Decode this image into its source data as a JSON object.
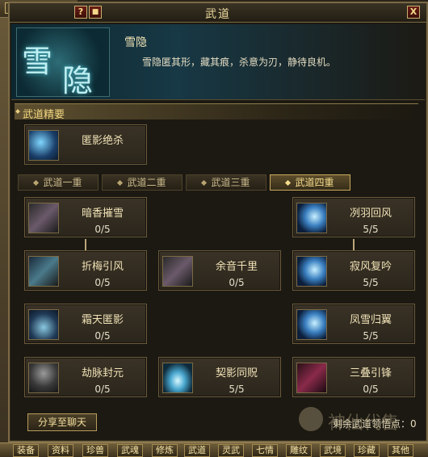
{
  "window": {
    "title": "武道",
    "help_label": "?",
    "close_label": "X"
  },
  "header": {
    "emblem_char1": "雪",
    "emblem_char2": "隐",
    "skill_name": "雪隐",
    "description": "雪隐匿其形，藏其痕，杀意为刃，静待良机。"
  },
  "essence": {
    "section_title": "武道精要",
    "card": {
      "name": "匿影绝杀",
      "icon": "ice-blade-icon"
    }
  },
  "tabs": [
    {
      "label": "武道一重",
      "active": false
    },
    {
      "label": "武道二重",
      "active": false
    },
    {
      "label": "武道三重",
      "active": false
    },
    {
      "label": "武道四重",
      "active": true
    }
  ],
  "skills": [
    {
      "name": "暗香摧雪",
      "level": "0/5",
      "icon": "blade-icon"
    },
    {
      "name": "冽羽回风",
      "level": "5/5",
      "icon": "moon-wind-icon"
    },
    {
      "name": "折梅引风",
      "level": "0/5",
      "icon": "blade-icon"
    },
    {
      "name": "余音千里",
      "level": "0/5",
      "icon": "blade-icon"
    },
    {
      "name": "寂风复吟",
      "level": "5/5",
      "icon": "moon-wind-icon"
    },
    {
      "name": "霜天匿影",
      "level": "0/5",
      "icon": "frost-icon"
    },
    {
      "name": "凤雪归翼",
      "level": "5/5",
      "icon": "moon-wind-icon"
    },
    {
      "name": "劫脉封元",
      "level": "0/5",
      "icon": "hooded-figure-icon"
    },
    {
      "name": "契影同贶",
      "level": "5/5",
      "icon": "whirlwind-icon"
    },
    {
      "name": "三叠引锋",
      "level": "0/5",
      "icon": "red-blade-icon"
    }
  ],
  "footer": {
    "share_label": "分享至聊天",
    "points_label": "剩余武道领悟点：0"
  },
  "bottom_bar": [
    "装备",
    "资料",
    "珍兽",
    "武魂",
    "修炼",
    "武道",
    "灵武",
    "七情",
    "雕纹",
    "武境",
    "珍藏",
    "其他"
  ],
  "watermark": "神仙代售"
}
